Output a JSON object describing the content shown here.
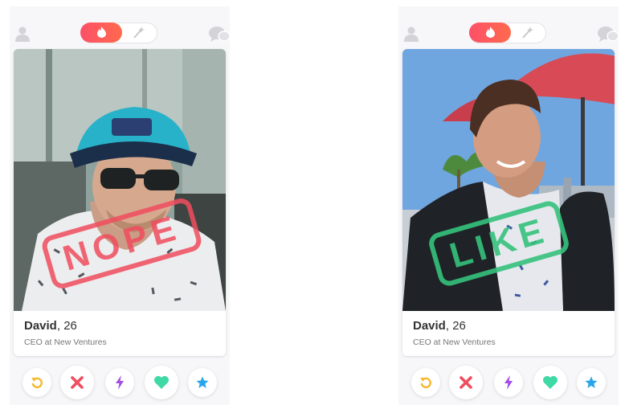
{
  "colors": {
    "brand_gradient_start": "#fd5068",
    "brand_gradient_end": "#ff6a4d",
    "nope_red": "#f04d5e",
    "like_green": "#35c27c",
    "rewind_yellow": "#f5b82e",
    "boost_purple": "#a34de3",
    "like_button_teal": "#3fd9a6",
    "superlike_blue": "#29a6e8"
  },
  "left_card": {
    "stamp": "NOPE",
    "name": "David",
    "age": ", 26",
    "job": "CEO at New Ventures"
  },
  "right_card": {
    "stamp": "LIKE",
    "name": "David",
    "age": ", 26",
    "job": "CEO at New Ventures"
  },
  "icons": {
    "profile": "profile-icon",
    "flame": "flame-icon",
    "explore": "sparkle-icon",
    "chat": "chat-icon",
    "rewind": "rewind-icon",
    "nope": "close-icon",
    "boost": "lightning-icon",
    "like": "heart-icon",
    "superlike": "star-icon"
  }
}
